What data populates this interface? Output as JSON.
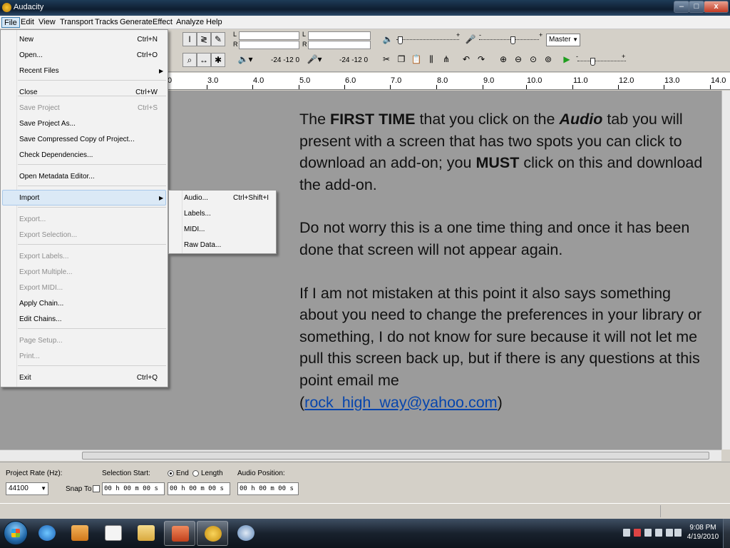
{
  "window": {
    "title": "Audacity",
    "min_glyph": "–",
    "max_glyph": "□",
    "close_glyph": "x"
  },
  "menubar": [
    "File",
    "Edit",
    "View",
    "Transport",
    "Tracks",
    "Generate",
    "Effect",
    "Analyze",
    "Help"
  ],
  "toolbar": {
    "meter_left": "L",
    "meter_right": "R",
    "meter_scale_1": "-24  -12  0",
    "meter_scale_2": "-24  -12  0",
    "output_device": "Master",
    "plus": "+",
    "minus": "-"
  },
  "ruler": [
    "0",
    "3.0",
    "4.0",
    "5.0",
    "6.0",
    "7.0",
    "8.0",
    "9.0",
    "10.0",
    "11.0",
    "12.0",
    "13.0",
    "14.0"
  ],
  "file_menu": {
    "items": [
      {
        "label": "New",
        "shortcut": "Ctrl+N",
        "disabled": false
      },
      {
        "label": "Open...",
        "shortcut": "Ctrl+O",
        "disabled": false
      },
      {
        "label": "Recent Files",
        "shortcut": "",
        "disabled": false,
        "submenu": true
      },
      {
        "label": "Close",
        "shortcut": "Ctrl+W",
        "disabled": false
      },
      {
        "label": "Save Project",
        "shortcut": "Ctrl+S",
        "disabled": true
      },
      {
        "label": "Save Project As...",
        "shortcut": "",
        "disabled": false
      },
      {
        "label": "Save Compressed Copy of Project...",
        "shortcut": "",
        "disabled": false
      },
      {
        "label": "Check Dependencies...",
        "shortcut": "",
        "disabled": false
      },
      {
        "label": "Open Metadata Editor...",
        "shortcut": "",
        "disabled": false
      },
      {
        "label": "Import",
        "shortcut": "",
        "disabled": false,
        "submenu": true
      },
      {
        "label": "Export...",
        "shortcut": "",
        "disabled": true
      },
      {
        "label": "Export Selection...",
        "shortcut": "",
        "disabled": true
      },
      {
        "label": "Export Labels...",
        "shortcut": "",
        "disabled": true
      },
      {
        "label": "Export Multiple...",
        "shortcut": "",
        "disabled": true
      },
      {
        "label": "Export MIDI...",
        "shortcut": "",
        "disabled": true
      },
      {
        "label": "Apply Chain...",
        "shortcut": "",
        "disabled": false
      },
      {
        "label": "Edit Chains...",
        "shortcut": "",
        "disabled": false
      },
      {
        "label": "Page Setup...",
        "shortcut": "",
        "disabled": true
      },
      {
        "label": "Print...",
        "shortcut": "",
        "disabled": true
      },
      {
        "label": "Exit",
        "shortcut": "Ctrl+Q",
        "disabled": false
      }
    ]
  },
  "import_menu": {
    "items": [
      {
        "label": "Audio...",
        "shortcut": "Ctrl+Shift+I"
      },
      {
        "label": "Labels...",
        "shortcut": ""
      },
      {
        "label": "MIDI...",
        "shortcut": ""
      },
      {
        "label": "Raw Data...",
        "shortcut": ""
      }
    ]
  },
  "overlay": {
    "p1_a": "The ",
    "p1_b": "FIRST TIME",
    "p1_c": " that you click on the ",
    "p1_d": "Audio",
    "p1_e": " tab you will present with a screen that has two spots you can click to download an add-on; you ",
    "p1_f": "MUST",
    "p1_g": " click on this and download the add-on.",
    "p2": "Do not worry this is a one time thing and once it has been done that screen will not appear again.",
    "p3": "If I am not mistaken at this point it also says something about you need to change the preferences in your library or something, I do not know for sure because it will not let me pull this screen back up, but if there is any questions at this point email me",
    "paren_open": "(",
    "email": "rock_high_way@yahoo.com",
    "paren_close": ")"
  },
  "selection_bar": {
    "project_rate_label": "Project Rate (Hz):",
    "project_rate_value": "44100",
    "snap_to_label": "Snap To",
    "selection_start_label": "Selection Start:",
    "end_label": "End",
    "length_label": "Length",
    "audio_position_label": "Audio Position:",
    "start_value": "00 h 00 m 00 s",
    "end_value": "00 h 00 m 00 s",
    "position_value": "00 h 00 m 00 s"
  },
  "taskbar": {
    "time": "9:08 PM",
    "date": "4/19/2010"
  }
}
